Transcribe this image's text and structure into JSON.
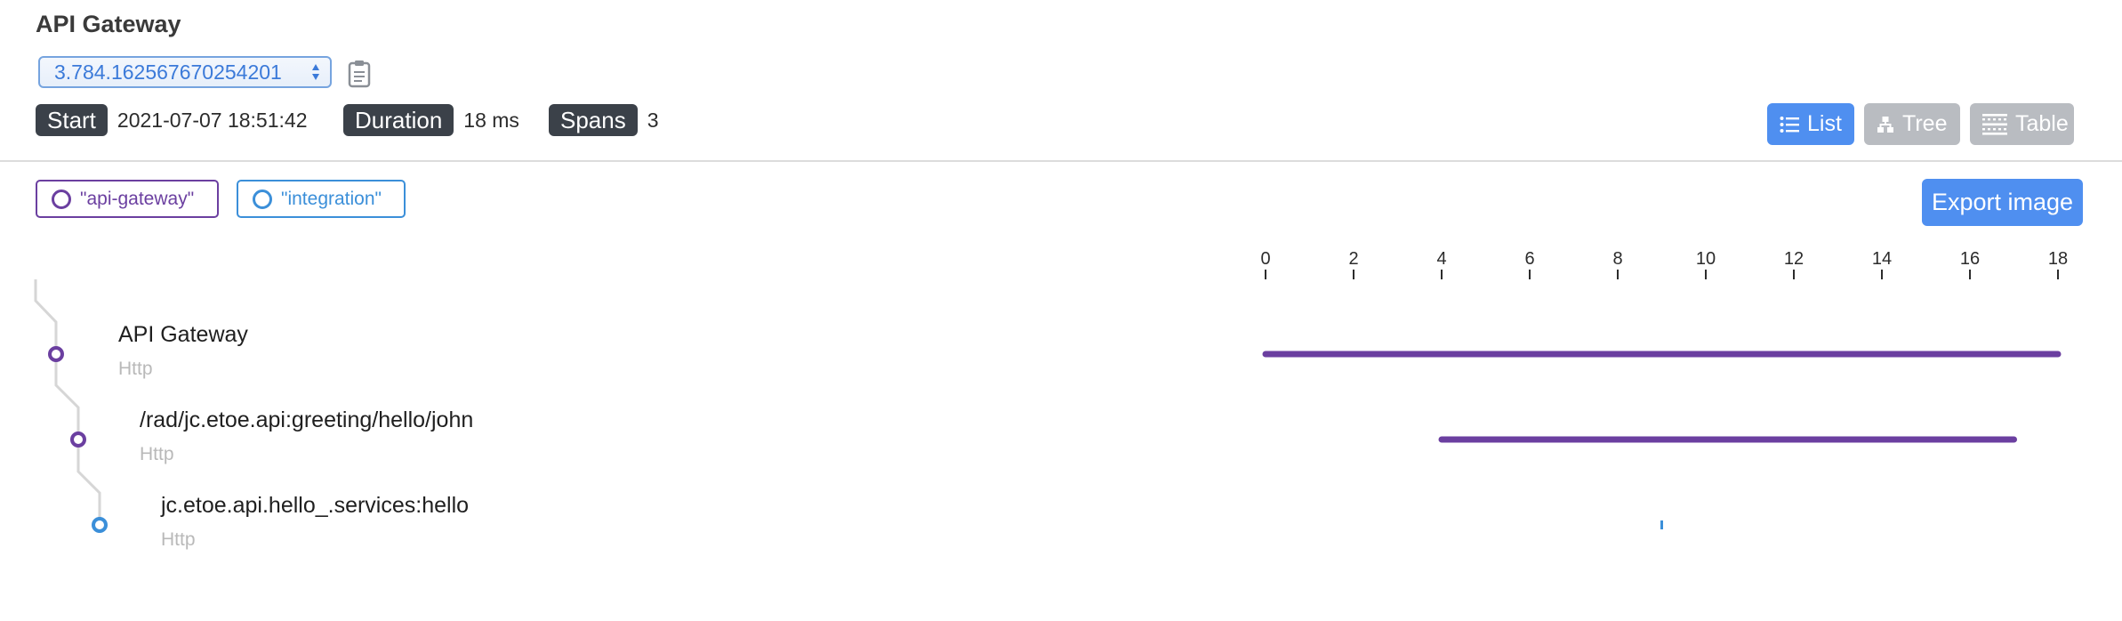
{
  "trace": {
    "title": "API Gateway",
    "selected_id": "3.784.162567670254201"
  },
  "meta": {
    "start_label": "Start",
    "start_value": "2021-07-07 18:51:42",
    "duration_label": "Duration",
    "duration_value": "18 ms",
    "spans_label": "Spans",
    "spans_value": "3"
  },
  "views": {
    "list": "List",
    "tree": "Tree",
    "table": "Table",
    "active": "list"
  },
  "legend": [
    {
      "label": "\"api-gateway\"",
      "color": "#6b3fa0"
    },
    {
      "label": "\"integration\"",
      "color": "#3b8fd9"
    }
  ],
  "export_label": "Export image",
  "timeline": {
    "ticks": [
      0,
      2,
      4,
      6,
      8,
      10,
      12,
      14,
      16,
      18
    ],
    "min": 0,
    "max": 18
  },
  "spans": [
    {
      "name": "API Gateway",
      "kind": "Http",
      "start": 0,
      "end": 18,
      "service": "api-gateway",
      "color": "#6b3fa0"
    },
    {
      "name": "/rad/jc.etoe.api:greeting/hello/john",
      "kind": "Http",
      "start": 4,
      "end": 17,
      "service": "api-gateway",
      "color": "#6b3fa0"
    },
    {
      "name": "jc.etoe.api.hello_.services:hello",
      "kind": "Http",
      "start": 9,
      "end": 9.02,
      "service": "integration",
      "color": "#3b8fd9"
    }
  ],
  "colors": {
    "accent": "#4f8ff0",
    "api_gateway": "#6b3fa0",
    "integration": "#3b8fd9",
    "tag_bg": "#3b4149",
    "inactive_btn": "#b9bcc1"
  }
}
